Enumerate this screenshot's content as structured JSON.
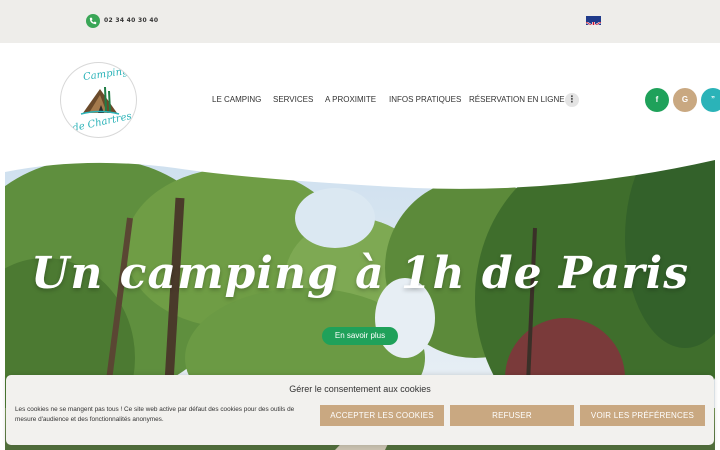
{
  "topbar": {
    "phone": "02 34 40 30 40",
    "phone_icon": "phone-icon",
    "language_icon": "uk-flag-icon"
  },
  "header": {
    "logo_text_top": "Camping",
    "logo_text_bottom": "de Chartres",
    "nav": [
      {
        "label": "LE CAMPING"
      },
      {
        "label": "SERVICES"
      },
      {
        "label": "A PROXIMITE"
      },
      {
        "label": "INFOS PRATIQUES"
      },
      {
        "label": "RÉSERVATION EN LIGNE"
      }
    ],
    "more_icon": "more-vertical-icon",
    "social": [
      {
        "label": "f",
        "icon": "facebook-icon",
        "color": "#1fa15a"
      },
      {
        "label": "G",
        "icon": "google-icon",
        "color": "#c9a881"
      },
      {
        "label": "”",
        "icon": "quote-icon",
        "color": "#2bb3b8"
      }
    ]
  },
  "hero": {
    "title": "Un camping à 1h de Paris",
    "cta": "En savoir plus"
  },
  "cookie": {
    "title": "Gérer le consentement aux cookies",
    "text": "Les cookies ne se mangent pas tous ! Ce site web active par défaut des cookies pour des outils de mesure d'audience et des fonctionnalités anonymes.",
    "accept": "ACCEPTER LES COOKIES",
    "refuse": "REFUSER",
    "prefs": "VOIR LES PRÉFÉRENCES"
  },
  "colors": {
    "green": "#1fa15a",
    "beige": "#c9a881",
    "teal": "#2bb3b8",
    "topbar_bg": "#eeedea"
  }
}
